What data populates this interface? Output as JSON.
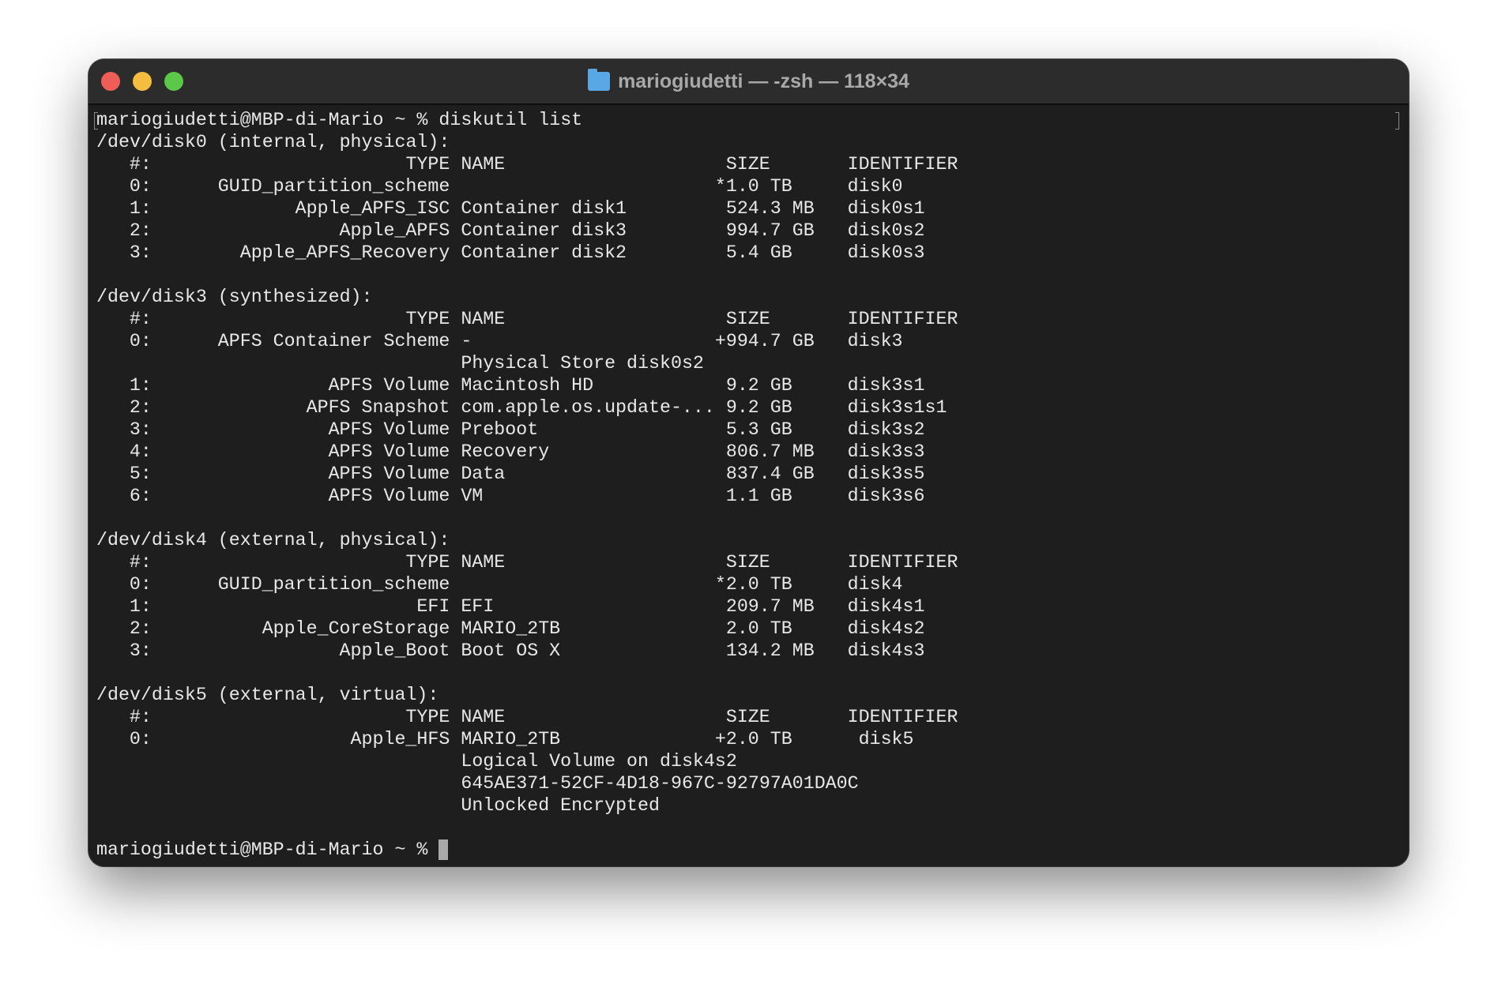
{
  "window": {
    "title": "mariogiudetti — -zsh — 118×34",
    "title_icon": "home-folder-icon"
  },
  "colors": {
    "background": "#1e1e1e",
    "text": "#e8e8e8",
    "close": "#ee5e57",
    "minimize": "#f5bd40",
    "maximize": "#5cc84a"
  },
  "prompt": "mariogiudetti@MBP-di-Mario ~ % ",
  "command": "diskutil list",
  "headers": {
    "num": "#:",
    "type": "TYPE",
    "name": "NAME",
    "size": "SIZE",
    "id": "IDENTIFIER"
  },
  "disks": [
    {
      "header": "/dev/disk0 (internal, physical):",
      "rows": [
        {
          "num": "0:",
          "type": "GUID_partition_scheme",
          "name": "",
          "marker": "*",
          "size": "1.0 TB",
          "id": "disk0"
        },
        {
          "num": "1:",
          "type": "Apple_APFS_ISC",
          "name": "Container disk1",
          "marker": "",
          "size": "524.3 MB",
          "id": "disk0s1"
        },
        {
          "num": "2:",
          "type": "Apple_APFS",
          "name": "Container disk3",
          "marker": "",
          "size": "994.7 GB",
          "id": "disk0s2"
        },
        {
          "num": "3:",
          "type": "Apple_APFS_Recovery",
          "name": "Container disk2",
          "marker": "",
          "size": "5.4 GB",
          "id": "disk0s3"
        }
      ]
    },
    {
      "header": "/dev/disk3 (synthesized):",
      "rows": [
        {
          "num": "0:",
          "type": "APFS Container Scheme",
          "name": "-",
          "marker": "+",
          "size": "994.7 GB",
          "id": "disk3",
          "extra": [
            "Physical Store disk0s2"
          ]
        },
        {
          "num": "1:",
          "type": "APFS Volume",
          "name": "Macintosh HD",
          "marker": "",
          "size": "9.2 GB",
          "id": "disk3s1"
        },
        {
          "num": "2:",
          "type": "APFS Snapshot",
          "name": "com.apple.os.update-...",
          "marker": "",
          "size": "9.2 GB",
          "id": "disk3s1s1"
        },
        {
          "num": "3:",
          "type": "APFS Volume",
          "name": "Preboot",
          "marker": "",
          "size": "5.3 GB",
          "id": "disk3s2"
        },
        {
          "num": "4:",
          "type": "APFS Volume",
          "name": "Recovery",
          "marker": "",
          "size": "806.7 MB",
          "id": "disk3s3"
        },
        {
          "num": "5:",
          "type": "APFS Volume",
          "name": "Data",
          "marker": "",
          "size": "837.4 GB",
          "id": "disk3s5"
        },
        {
          "num": "6:",
          "type": "APFS Volume",
          "name": "VM",
          "marker": "",
          "size": "1.1 GB",
          "id": "disk3s6"
        }
      ]
    },
    {
      "header": "/dev/disk4 (external, physical):",
      "rows": [
        {
          "num": "0:",
          "type": "GUID_partition_scheme",
          "name": "",
          "marker": "*",
          "size": "2.0 TB",
          "id": "disk4"
        },
        {
          "num": "1:",
          "type": "EFI",
          "name": "EFI",
          "marker": "",
          "size": "209.7 MB",
          "id": "disk4s1"
        },
        {
          "num": "2:",
          "type": "Apple_CoreStorage",
          "name": "MARIO_2TB",
          "marker": "",
          "size": "2.0 TB",
          "id": "disk4s2"
        },
        {
          "num": "3:",
          "type": "Apple_Boot",
          "name": "Boot OS X",
          "marker": "",
          "size": "134.2 MB",
          "id": "disk4s3"
        }
      ]
    },
    {
      "header": "/dev/disk5 (external, virtual):",
      "rows": [
        {
          "num": "0:",
          "type": "Apple_HFS",
          "name": "MARIO_2TB",
          "marker": "+",
          "size": "2.0 TB",
          "id": " disk5",
          "extra": [
            "Logical Volume on disk4s2",
            "645AE371-52CF-4D18-967C-92797A01DA0C",
            "Unlocked Encrypted"
          ]
        }
      ]
    }
  ]
}
